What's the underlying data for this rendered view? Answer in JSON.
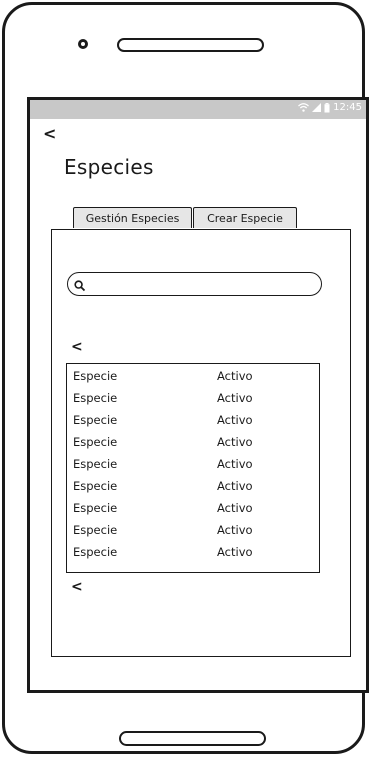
{
  "status_bar": {
    "time": "12:45"
  },
  "page": {
    "title": "Especies",
    "back_symbol": "<"
  },
  "tabs": [
    {
      "label": "Gestión Especies",
      "active": true
    },
    {
      "label": "Crear Especie",
      "active": false
    }
  ],
  "search": {
    "value": "",
    "placeholder": ""
  },
  "list": {
    "prev_symbol": "<",
    "next_symbol": "<",
    "rows": [
      {
        "name": "Especie",
        "status": "Activo"
      },
      {
        "name": "Especie",
        "status": "Activo"
      },
      {
        "name": "Especie",
        "status": "Activo"
      },
      {
        "name": "Especie",
        "status": "Activo"
      },
      {
        "name": "Especie",
        "status": "Activo"
      },
      {
        "name": "Especie",
        "status": "Activo"
      },
      {
        "name": "Especie",
        "status": "Activo"
      },
      {
        "name": "Especie",
        "status": "Activo"
      },
      {
        "name": "Especie",
        "status": "Activo"
      }
    ]
  },
  "icons": {
    "status": [
      "wifi-icon",
      "signal-icon",
      "battery-icon"
    ],
    "search": "search-icon"
  },
  "colors": {
    "status_bar": "#c8c8c8",
    "tab_background": "#e6e6e6",
    "stroke": "#1a1a1a"
  }
}
